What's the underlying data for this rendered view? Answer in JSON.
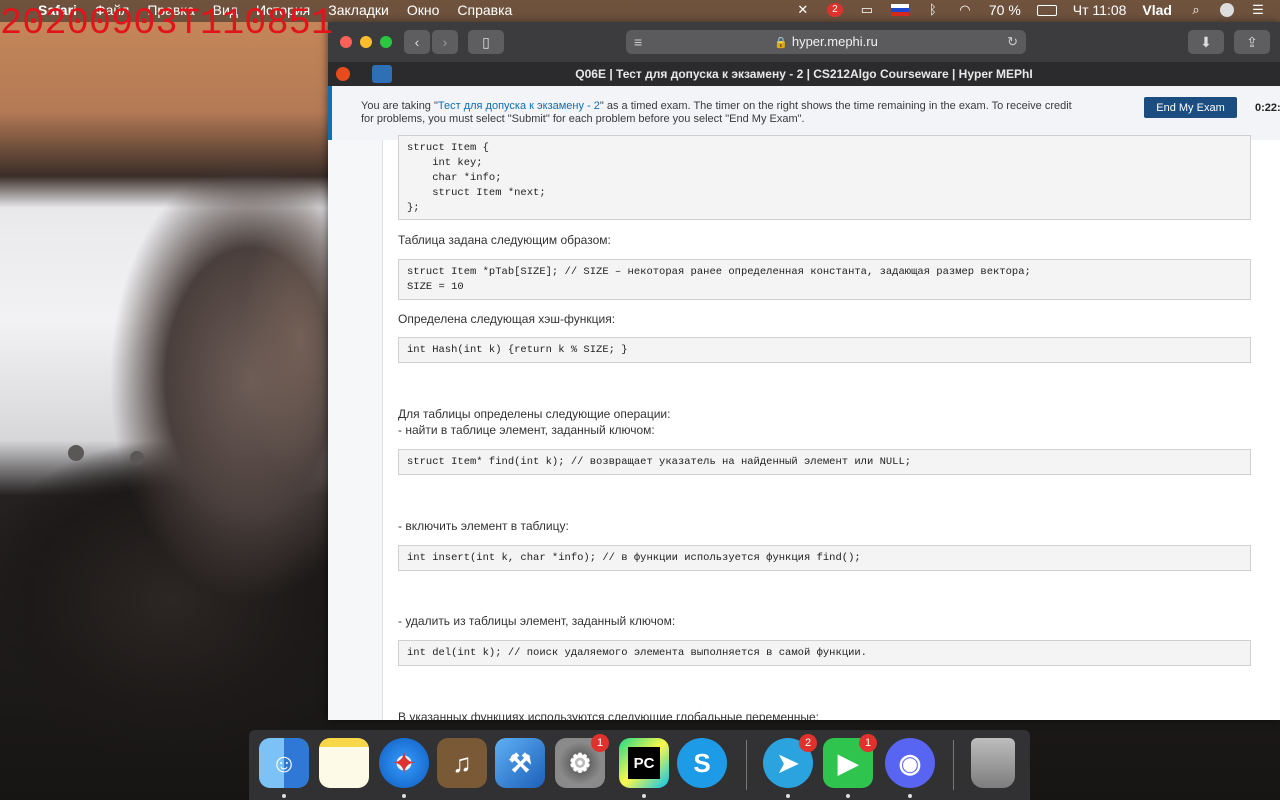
{
  "overlay": {
    "timestamp": "20200903T110851"
  },
  "menubar": {
    "apple": "",
    "app_name": "Safari",
    "menus": [
      "Файл",
      "Правка",
      "Вид",
      "История",
      "Закладки",
      "Окно",
      "Справка"
    ],
    "battery": "70 %",
    "clock": "Чт 11:08",
    "user": "Vlad",
    "notification_badge": "2"
  },
  "browser": {
    "url": "hyper.mephi.ru",
    "tab_title": "Q06E | Тест для допуска к экзамену - 2 | CS212Algo Courseware | Hyper MEPhI"
  },
  "banner": {
    "text_before": "You are taking \"",
    "exam_link": "Тест для допуска к экзамену - 2",
    "text_after": "\" as a timed exam. The timer on the right shows the time remaining in the exam. To receive credit for problems, you must select \"Submit\" for each problem before you select \"End My Exam\".",
    "end_button": "End My Exam",
    "timer": "0:22:"
  },
  "problem": {
    "code_struct": "struct Item {\n    int key;\n    char *info;\n    struct Item *next;\n};",
    "p_table": "Таблица задана следующим образом:",
    "code_table": "struct Item *pTab[SIZE]; // SIZE – некоторая ранее определенная константа, задающая размер вектора;\nSIZE = 10",
    "p_hash": "Определена следующая хэш-функция:",
    "code_hash": "int Hash(int k) {return k % SIZE; }",
    "p_ops": "Для таблицы определены следующие операции:",
    "p_find": "- найти в таблице элемент, заданный ключом:",
    "code_find": "struct Item* find(int k); // возвращает указатель на найденный элемент или NULL;",
    "p_insert": "- включить элемент в таблицу:",
    "code_insert": "int insert(int k, char *info); // в функции используется функция find();",
    "p_delete": "- удалить из таблицы элемент, заданный ключом:",
    "code_delete": "int del(int k); // поиск удаляемого элемента выполняется в самой функции.",
    "p_globals": "В указанных функциях используются следующие глобальные переменные:"
  },
  "dock": {
    "apps": [
      {
        "name": "Finder",
        "icon": "finder-icon",
        "color": "#3b8fe6"
      },
      {
        "name": "Notes",
        "icon": "notes-icon",
        "color": "#f7e27a"
      },
      {
        "name": "Safari",
        "icon": "safari-icon",
        "color": "#2d8ef0"
      },
      {
        "name": "GarageBand",
        "icon": "guitar-icon",
        "color": "#6b4a2e"
      },
      {
        "name": "Xcode",
        "icon": "xcode-icon",
        "color": "#2b7fd4"
      },
      {
        "name": "System Preferences",
        "icon": "gear-icon",
        "color": "#8a8a8a",
        "badge": "1"
      },
      {
        "name": "PyCharm",
        "icon": "pycharm-icon",
        "color": "#21d789"
      },
      {
        "name": "Skype",
        "icon": "skype-icon",
        "color": "#1e9be6"
      },
      {
        "name": "Telegram",
        "icon": "telegram-icon",
        "color": "#2aa3df",
        "badge": "2"
      },
      {
        "name": "FaceTime",
        "icon": "facetime-icon",
        "color": "#2fc44d",
        "badge": "1"
      },
      {
        "name": "Discord",
        "icon": "discord-icon",
        "color": "#5865f2"
      },
      {
        "name": "Trash",
        "icon": "trash-icon",
        "color": "#8c8c8c"
      }
    ]
  },
  "colors": {
    "accent": "#0f6fb4",
    "end_button": "#1b4d80",
    "timestamp": "#e0141a"
  }
}
